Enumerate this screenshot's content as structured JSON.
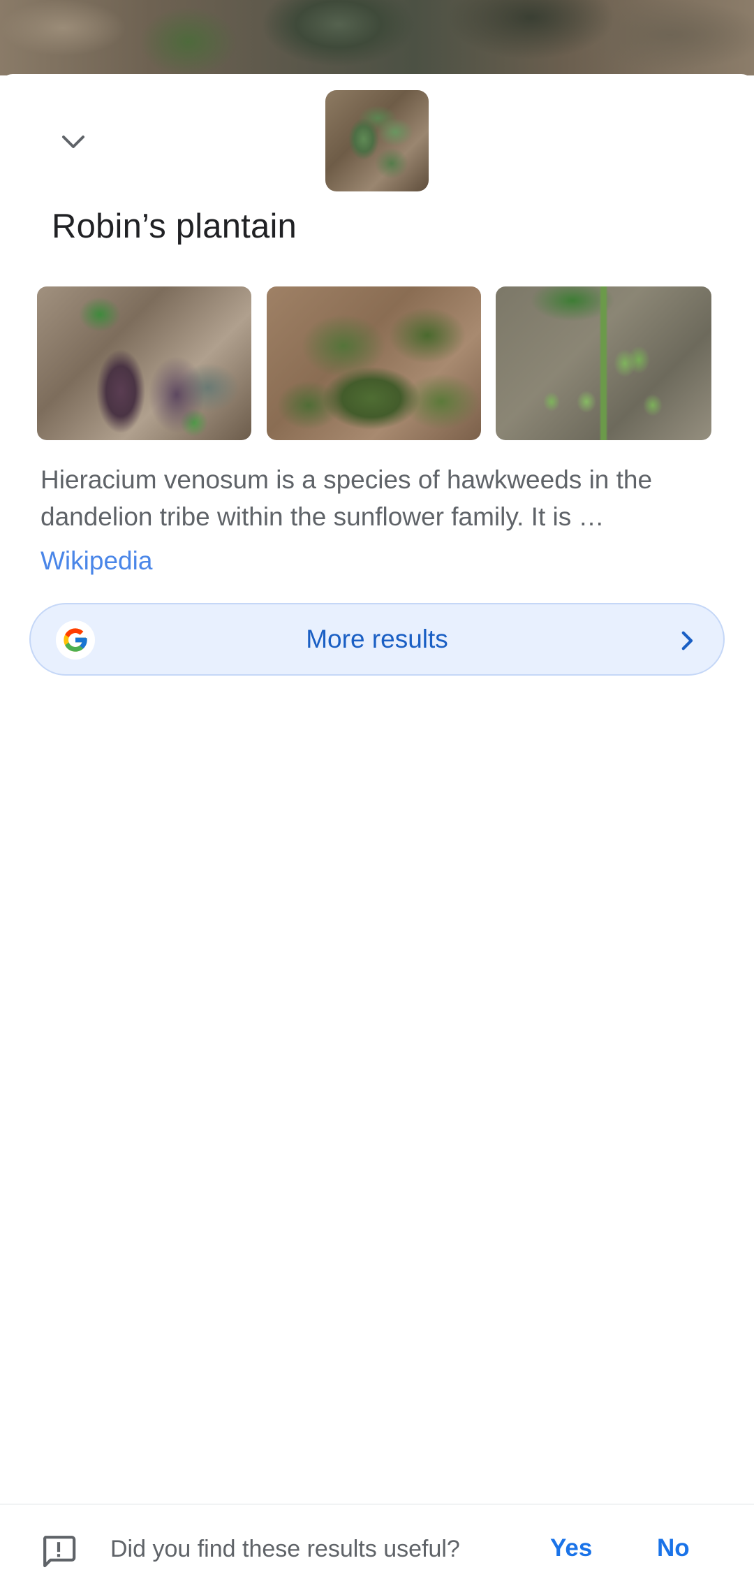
{
  "result": {
    "title": "Robin’s plantain",
    "description": "Hieracium venosum is a species of hawkweeds in the dandelion tribe within the sunflower family. It is …",
    "source_link": "Wikipedia"
  },
  "images": [
    {
      "name": "gallery-image-1"
    },
    {
      "name": "gallery-image-2"
    },
    {
      "name": "gallery-image-3"
    }
  ],
  "more_results": {
    "label": "More results",
    "icon": "google-g-icon",
    "chevron_icon": "chevron-right-icon"
  },
  "header": {
    "collapse_icon": "chevron-down-icon"
  },
  "feedback": {
    "icon": "feedback-icon",
    "question": "Did you find these results useful?",
    "yes_label": "Yes",
    "no_label": "No"
  },
  "colors": {
    "accent": "#1a73e8",
    "link": "#4a86e8",
    "more_results_bg": "#e8f0fe",
    "title_text": "#202124",
    "body_text": "#5f6368"
  }
}
